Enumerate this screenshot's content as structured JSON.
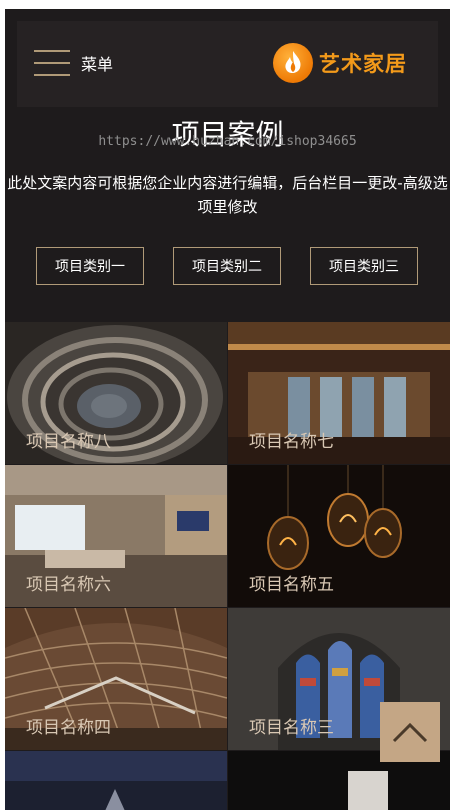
{
  "header": {
    "menu_label": "菜单",
    "logo_text": "艺术家居",
    "logo_icon": "flame-icon"
  },
  "watermark": "https://www.huzhan.com/ishop34665",
  "page": {
    "title": "项目案例",
    "intro": "此处文案内容可根据您企业内容进行编辑，后台栏目一更改-高级选项里修改"
  },
  "categories": [
    "项目类别一",
    "项目类别二",
    "项目类别三"
  ],
  "projects": [
    {
      "name": "项目名称八"
    },
    {
      "name": "项目名称七"
    },
    {
      "name": "项目名称六"
    },
    {
      "name": "项目名称五"
    },
    {
      "name": "项目名称四"
    },
    {
      "name": "项目名称三"
    }
  ],
  "colors": {
    "background": "#1e1b1c",
    "accent": "#b09a78",
    "logo": "#f39a1a",
    "back_to_top": "#c4a685"
  }
}
